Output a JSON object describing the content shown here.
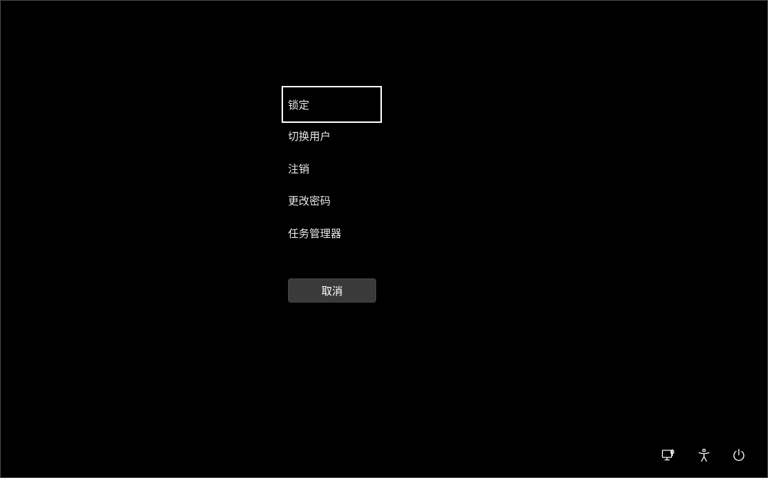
{
  "menu": {
    "items": [
      {
        "label": "锁定"
      },
      {
        "label": "切换用户"
      },
      {
        "label": "注销"
      },
      {
        "label": "更改密码"
      },
      {
        "label": "任务管理器"
      }
    ],
    "focused_index": 0
  },
  "cancel_button": {
    "label": "取消"
  },
  "tray": {
    "icons": [
      "network-icon",
      "accessibility-icon",
      "power-icon"
    ]
  },
  "colors": {
    "background": "#000000",
    "text": "#e8e8e8",
    "focus_border": "#ffffff",
    "button_bg": "#3a3a3a"
  }
}
